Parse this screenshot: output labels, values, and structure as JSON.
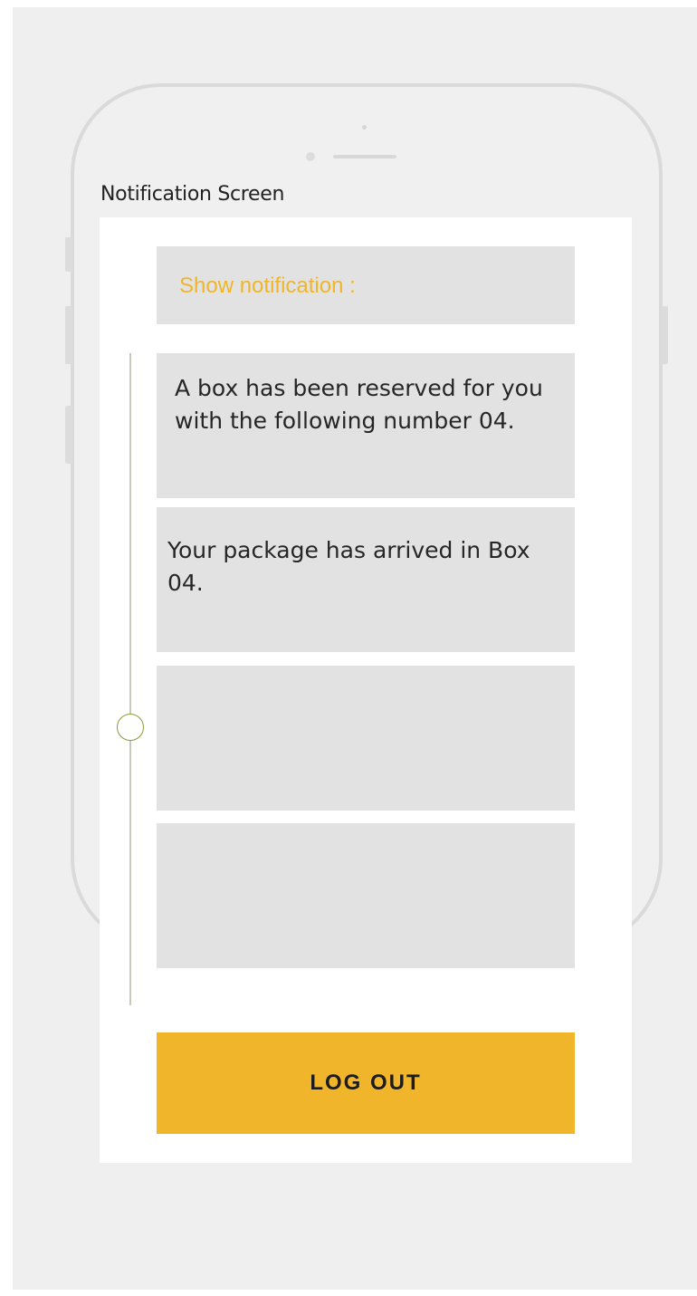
{
  "screen": {
    "title": "Notification Screen"
  },
  "header": {
    "label": "Show notification :"
  },
  "notifications": [
    {
      "text": "A box has been reserved for you with the following number 04."
    },
    {
      "text": "Your package has arrived in Box 04."
    },
    {
      "text": ""
    },
    {
      "text": ""
    }
  ],
  "actions": {
    "logout_label": "LOG OUT"
  },
  "colors": {
    "accent": "#f0b52a",
    "card_bg": "#e2e2e2",
    "scroll_thumb_border": "#8a9a3a"
  }
}
